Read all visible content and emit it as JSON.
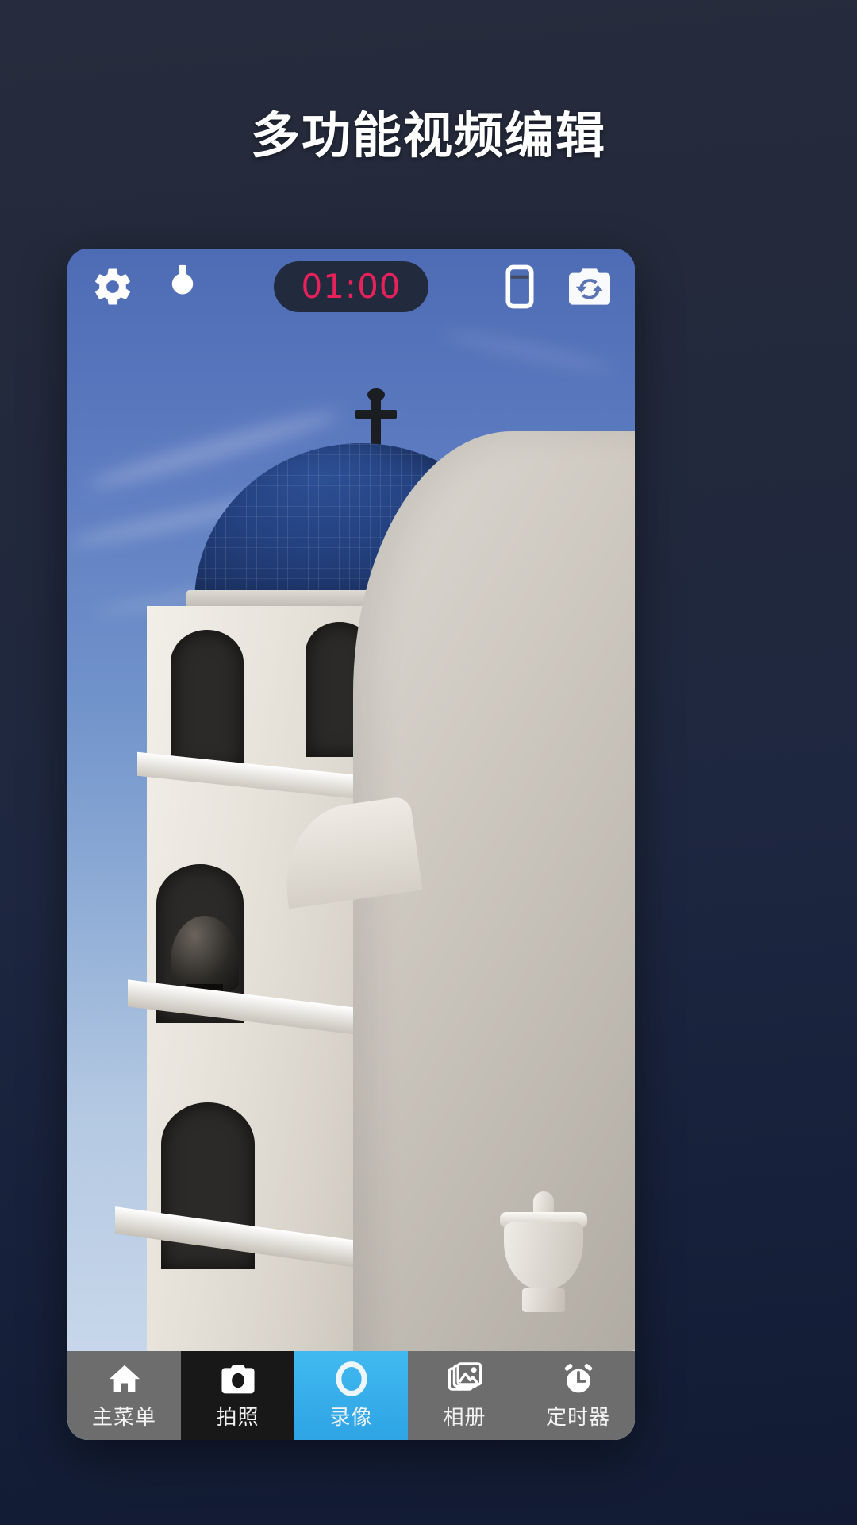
{
  "headline": "多功能视频编辑",
  "colors": {
    "page_background": "#242a3b",
    "accent_blue": "#34ace0",
    "timer_red": "#e8215a",
    "nav_gray": "#6d6d6d",
    "nav_dark": "#181818"
  },
  "phone": {
    "topbar": {
      "settings_icon": "gear-icon",
      "flash_icon": "flashlight-icon",
      "timer_value": "01:00",
      "aspect_icon": "phone-ratio-icon",
      "switch_camera_icon": "camera-switch-icon"
    },
    "viewfinder": {
      "description": "church-bell-tower-photo"
    },
    "bottom_nav": [
      {
        "label": "主菜单",
        "icon": "home-icon",
        "state": "normal"
      },
      {
        "label": "拍照",
        "icon": "camera-icon",
        "state": "dark"
      },
      {
        "label": "录像",
        "icon": "record-ring-icon",
        "state": "active"
      },
      {
        "label": "相册",
        "icon": "gallery-icon",
        "state": "normal"
      },
      {
        "label": "定时器",
        "icon": "alarm-clock-icon",
        "state": "normal"
      }
    ]
  }
}
